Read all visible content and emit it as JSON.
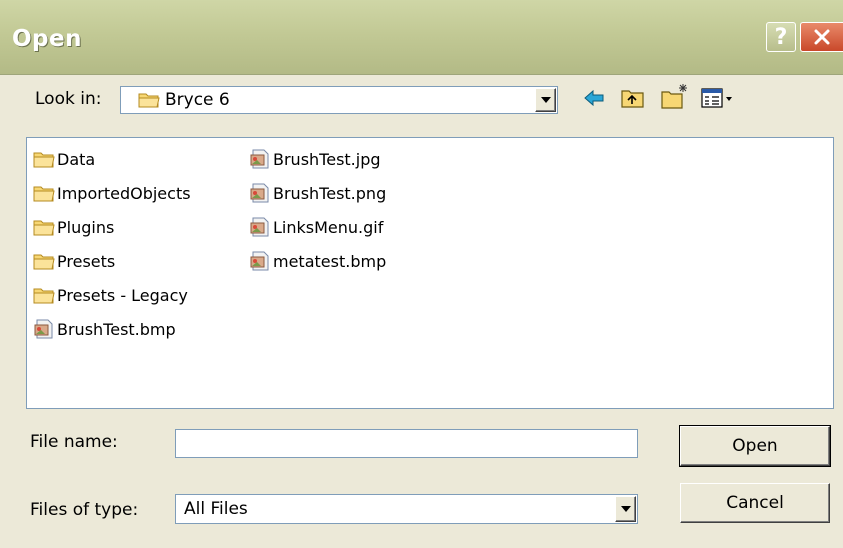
{
  "window": {
    "title": "Open"
  },
  "title_buttons": {
    "help": "?",
    "close": "close"
  },
  "look_in": {
    "label": "Look in:",
    "value": "Bryce 6"
  },
  "toolbar": {
    "back": "back-arrow",
    "up": "up-folder",
    "new_folder": "new-folder",
    "view_menu": "view-menu"
  },
  "files": {
    "column1": [
      {
        "name": "Data",
        "type": "folder"
      },
      {
        "name": "ImportedObjects",
        "type": "folder"
      },
      {
        "name": "Plugins",
        "type": "folder"
      },
      {
        "name": "Presets",
        "type": "folder"
      },
      {
        "name": "Presets - Legacy",
        "type": "folder"
      },
      {
        "name": "BrushTest.bmp",
        "type": "image"
      }
    ],
    "column2": [
      {
        "name": "BrushTest.jpg",
        "type": "image"
      },
      {
        "name": "BrushTest.png",
        "type": "image"
      },
      {
        "name": "LinksMenu.gif",
        "type": "image"
      },
      {
        "name": "metatest.bmp",
        "type": "image"
      }
    ]
  },
  "file_name": {
    "label": "File name:",
    "value": ""
  },
  "files_of_type": {
    "label": "Files of type:",
    "value": "All Files"
  },
  "buttons": {
    "open": "Open",
    "cancel": "Cancel"
  },
  "colors": {
    "titlebar": "#c2c995",
    "dialog_bg": "#ece9d8",
    "border": "#7f9db9",
    "close_button": "#c9482a"
  }
}
